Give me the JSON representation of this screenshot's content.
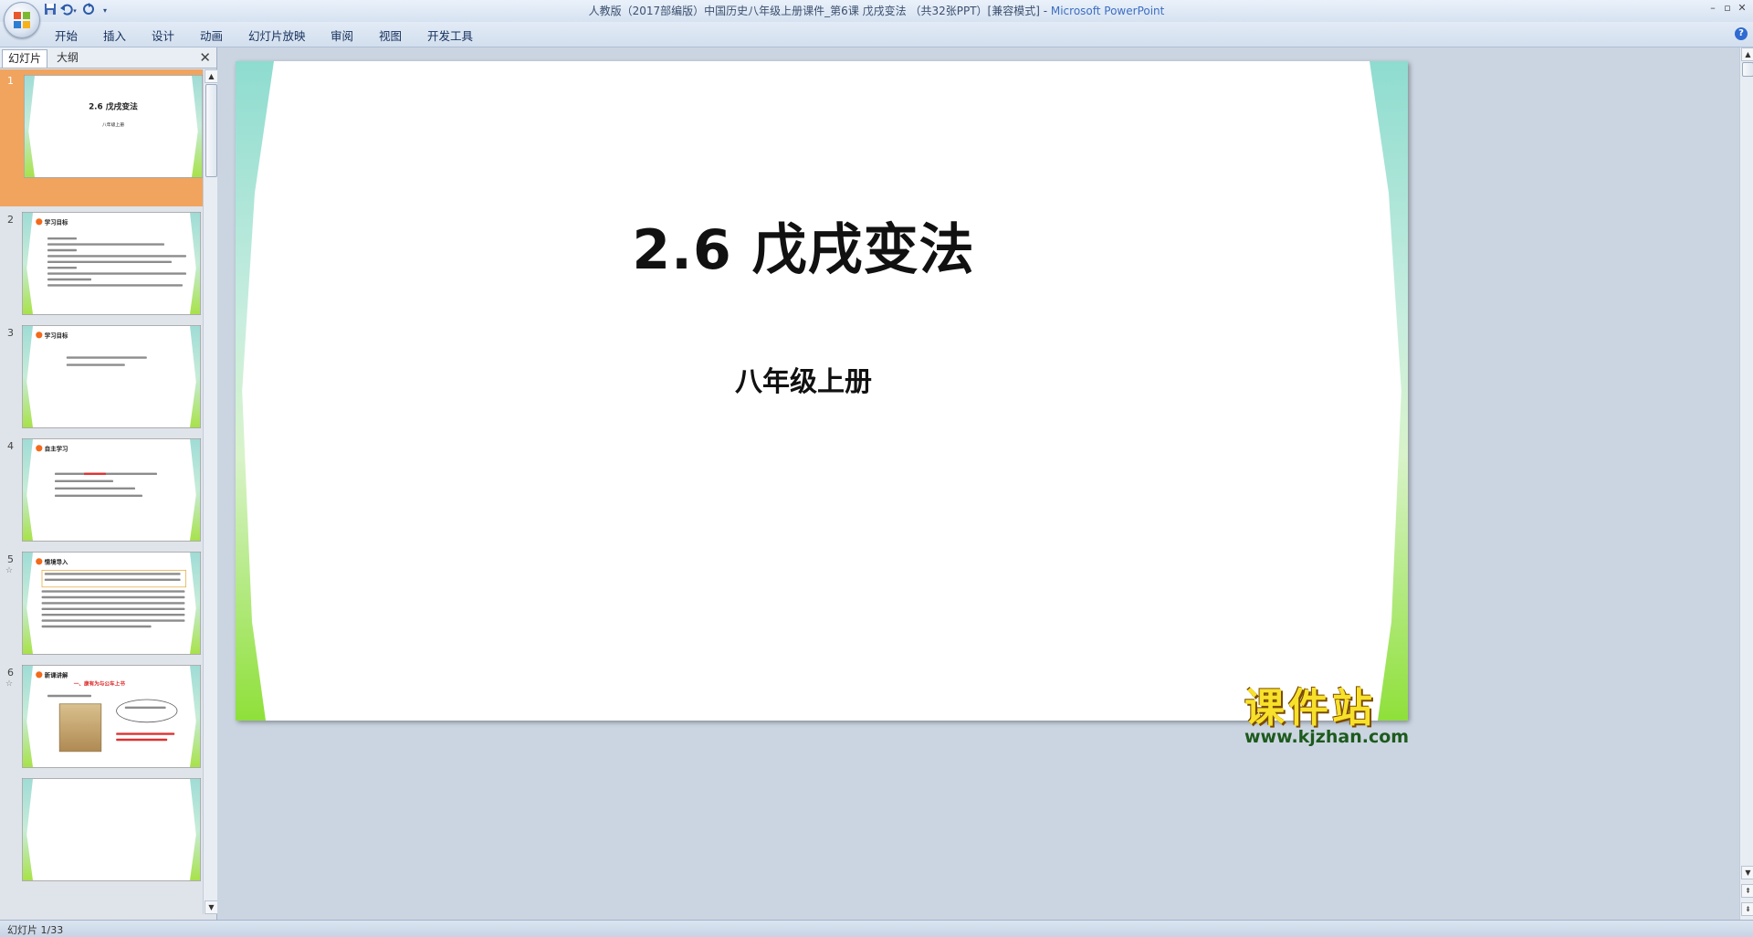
{
  "window": {
    "title": "人教版（2017部编版）中国历史八年级上册课件_第6课 戊戌变法 （共32张PPT）[兼容模式]",
    "app_name": "Microsoft PowerPoint",
    "separator": " - "
  },
  "quick_access": {
    "save_icon": "save-icon",
    "undo_icon": "undo-icon",
    "redo_icon": "redo-icon",
    "customize_icon": "dropdown-arrow-icon"
  },
  "ribbon": {
    "tabs": [
      "开始",
      "插入",
      "设计",
      "动画",
      "幻灯片放映",
      "审阅",
      "视图",
      "开发工具"
    ]
  },
  "panel": {
    "tab_slides": "幻灯片",
    "tab_outline": "大纲",
    "close": "✕"
  },
  "thumbnails": [
    {
      "num": "1",
      "title": "2.6 戊戌变法",
      "subtitle": "八年级上册"
    },
    {
      "num": "2",
      "heading": "学习目标"
    },
    {
      "num": "3",
      "heading": "学习目标"
    },
    {
      "num": "4",
      "heading": "自主学习"
    },
    {
      "num": "5",
      "heading": "情境导入"
    },
    {
      "num": "6",
      "heading": "新课讲解",
      "title": "一、康有为与公车上书"
    }
  ],
  "slide": {
    "title": "2.6 戊戌变法",
    "subtitle": "八年级上册"
  },
  "watermark": {
    "text": "课件站",
    "url": "www.kjzhan.com"
  },
  "status": {
    "slide_counter": "幻灯片 1/33"
  },
  "colors": {
    "accent_selected": "#f1a45e",
    "app_name": "#3d6ec2",
    "deco_green": "#8fe03a",
    "deco_teal": "#8edcd0"
  }
}
